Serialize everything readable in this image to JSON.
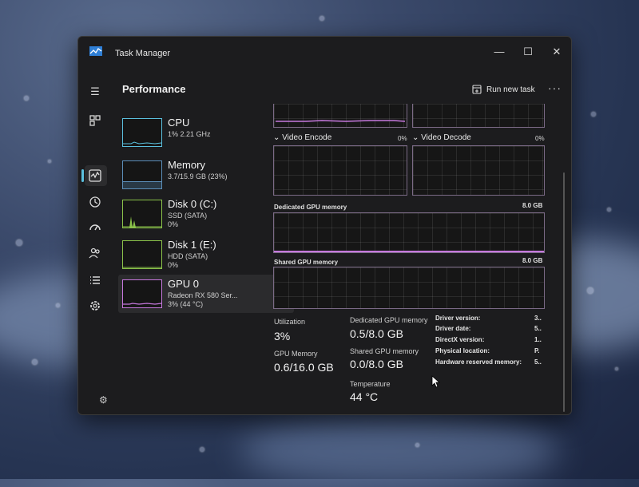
{
  "window": {
    "title": "Task Manager",
    "controls": {
      "minimize": "—",
      "maximize": "☐",
      "close": "✕"
    }
  },
  "header": {
    "title": "Performance",
    "run_new_task": "Run new task",
    "more": "···"
  },
  "devices": [
    {
      "name": "CPU",
      "sub": "1% 2.21 GHz",
      "sub2": "",
      "color": "#5bc0de"
    },
    {
      "name": "Memory",
      "sub": "3.7/15.9 GB (23%)",
      "sub2": "",
      "color": "#5b8db8"
    },
    {
      "name": "Disk 0 (C:)",
      "sub": "SSD (SATA)",
      "sub2": "0%",
      "color": "#8bc34a"
    },
    {
      "name": "Disk 1 (E:)",
      "sub": "HDD (SATA)",
      "sub2": "0%",
      "color": "#8bc34a"
    },
    {
      "name": "GPU 0",
      "sub": "Radeon RX 580 Ser...",
      "sub2": "3% (44 °C)",
      "color": "#c678dd"
    }
  ],
  "gpu": {
    "video_encode": {
      "label": "Video Encode",
      "pct": "0%"
    },
    "video_decode": {
      "label": "Video Decode",
      "pct": "0%"
    },
    "dedicated_mem": {
      "label": "Dedicated GPU memory",
      "max": "8.0 GB"
    },
    "shared_mem": {
      "label": "Shared GPU memory",
      "max": "8.0 GB"
    },
    "stats": {
      "utilization": {
        "label": "Utilization",
        "value": "3%"
      },
      "gpu_memory": {
        "label": "GPU Memory",
        "value": "0.6/16.0 GB"
      },
      "dedicated": {
        "label": "Dedicated GPU memory",
        "value": "0.5/8.0 GB"
      },
      "shared": {
        "label": "Shared GPU memory",
        "value": "0.0/8.0 GB"
      },
      "temperature": {
        "label": "Temperature",
        "value": "44 °C"
      }
    },
    "info": [
      {
        "label": "Driver version:",
        "value": "3.."
      },
      {
        "label": "Driver date:",
        "value": "5.."
      },
      {
        "label": "DirectX version:",
        "value": "1.."
      },
      {
        "label": "Physical location:",
        "value": "P."
      },
      {
        "label": "Hardware reserved memory:",
        "value": "5.."
      }
    ]
  },
  "colors": {
    "accent": "#5bc0de",
    "gpu": "#c678dd",
    "window_bg": "#1c1c1e"
  }
}
